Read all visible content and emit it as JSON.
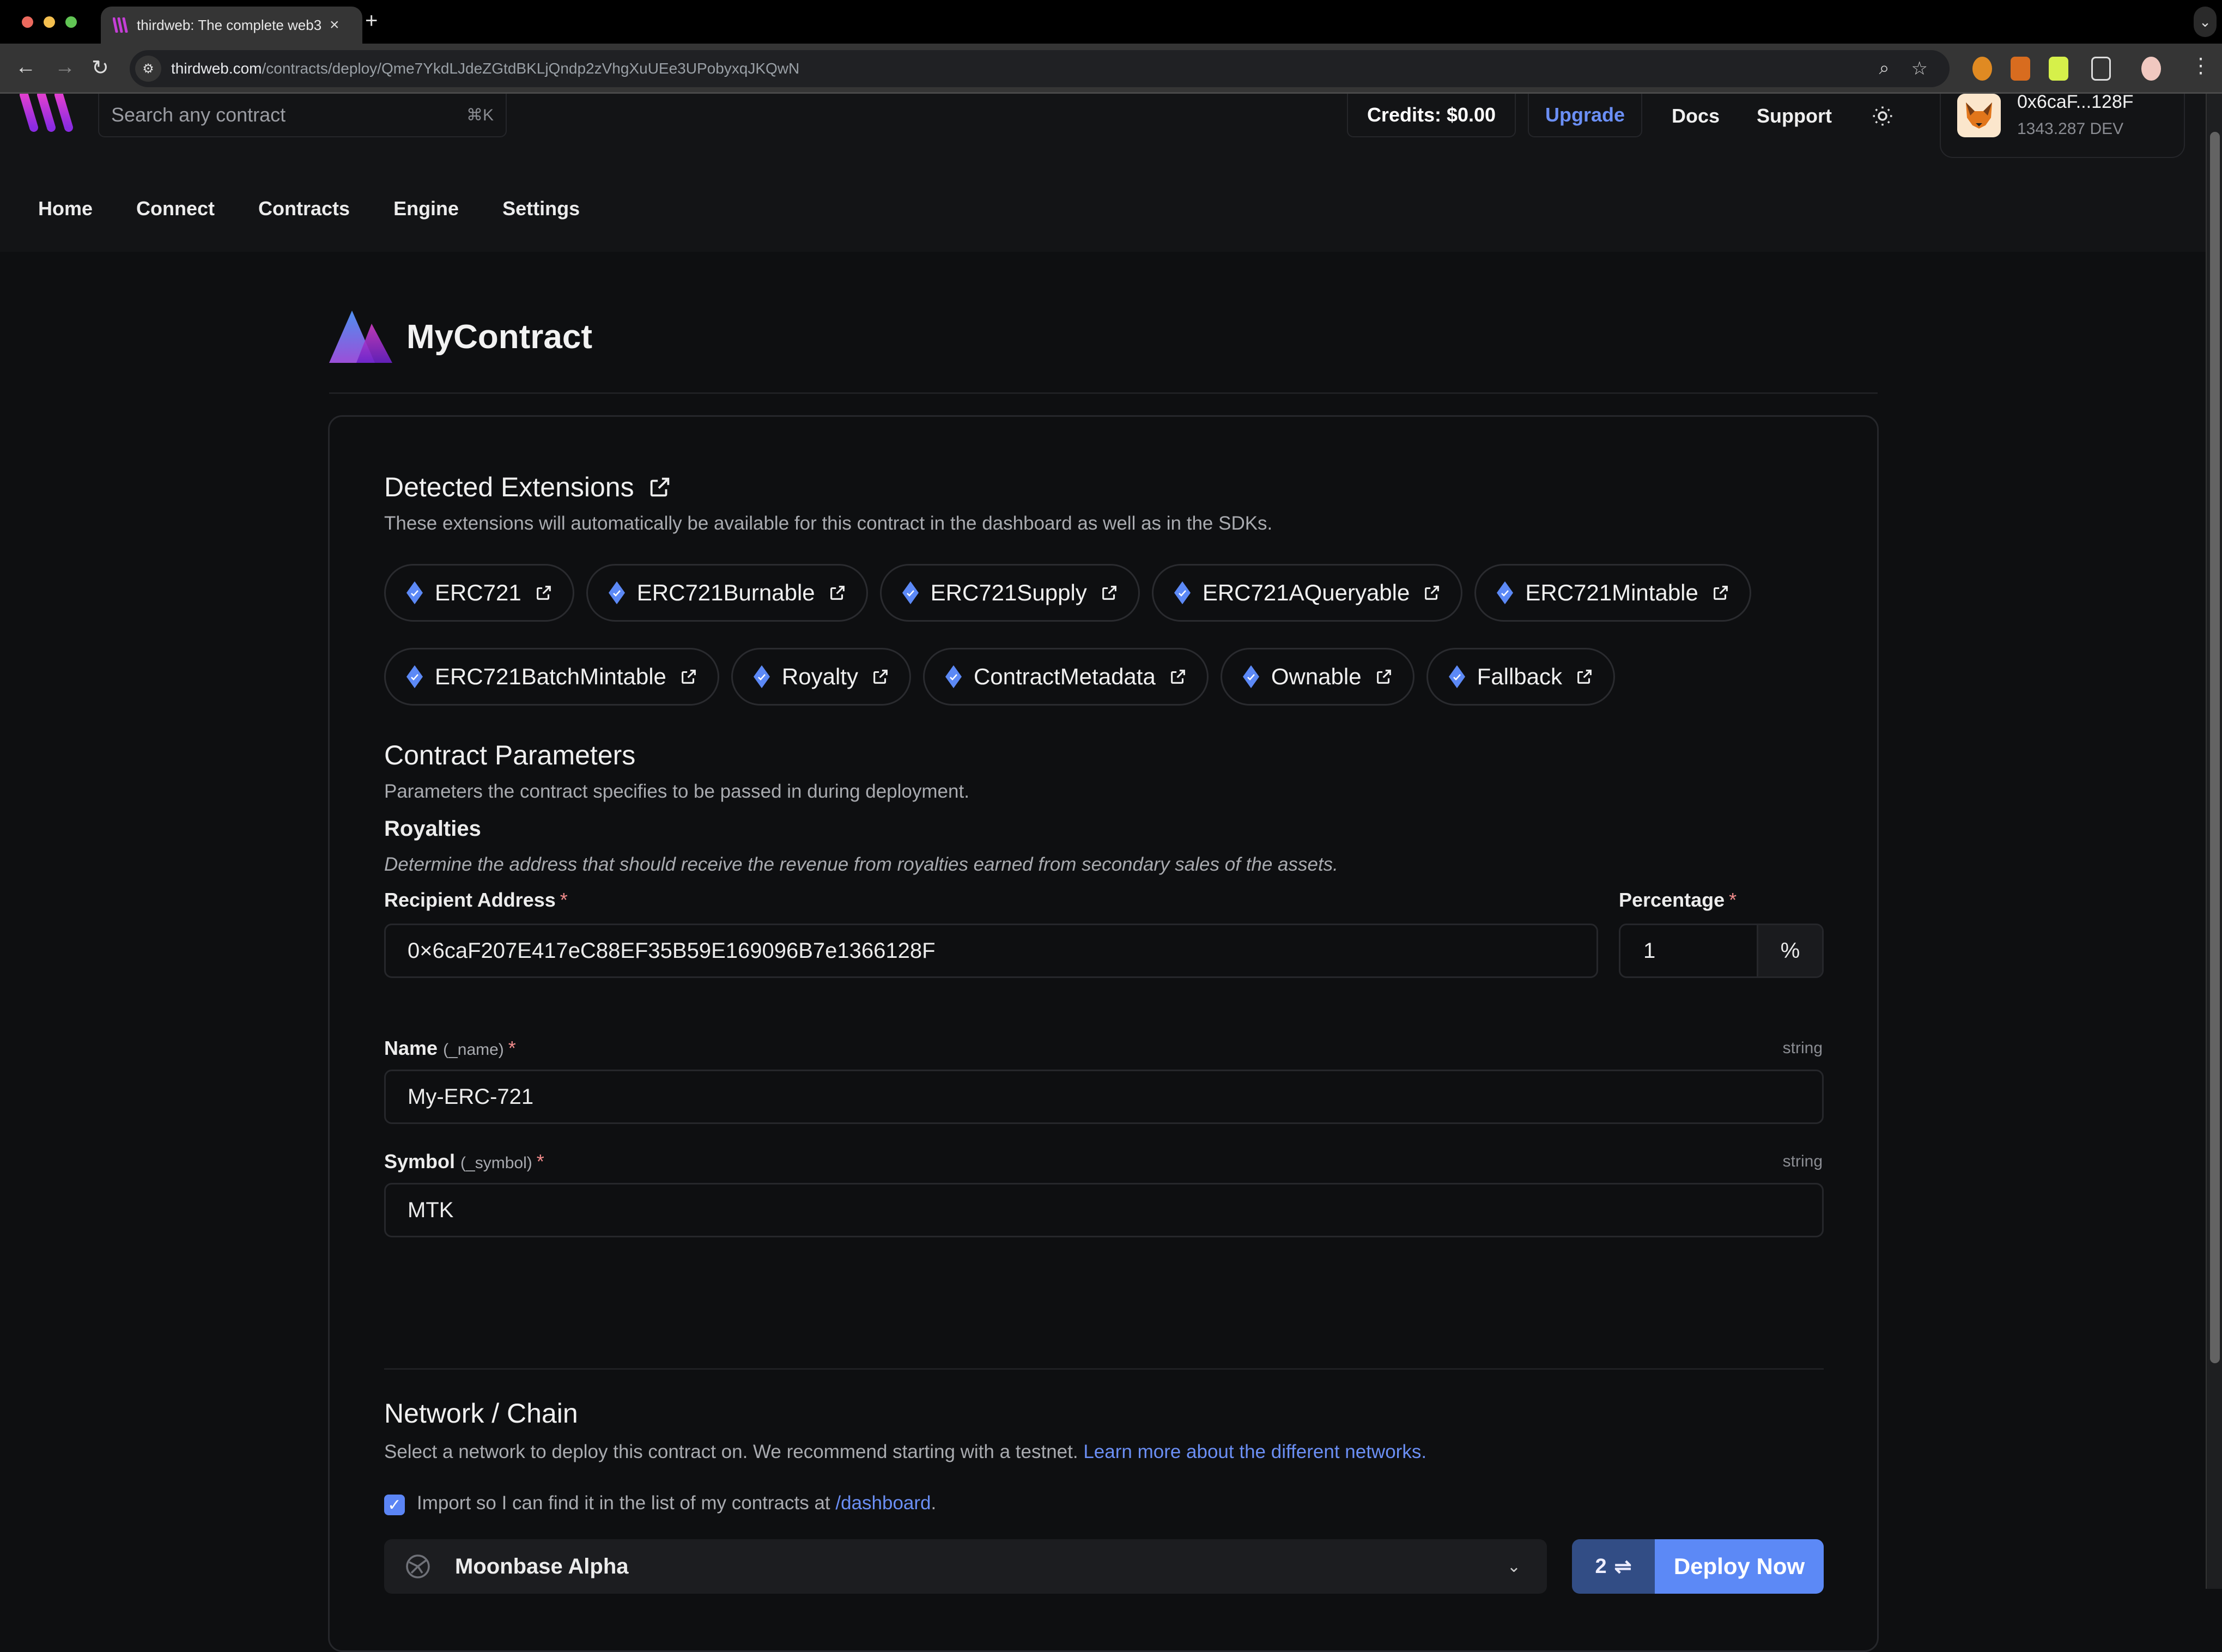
{
  "browser": {
    "tab_title": "thirdweb: The complete web3",
    "url_host": "thirdweb.com",
    "url_path": "/contracts/deploy/Qme7YkdLJdeZGtdBKLjQndp2zVhgXuUEe3UPobyxqJKQwN"
  },
  "header": {
    "search_placeholder": "Search any contract",
    "search_shortcut": "⌘K",
    "credits": "Credits: $0.00",
    "upgrade": "Upgrade",
    "docs": "Docs",
    "support": "Support",
    "wallet_address": "0x6caF...128F",
    "wallet_balance": "1343.287 DEV"
  },
  "nav": [
    "Home",
    "Connect",
    "Contracts",
    "Engine",
    "Settings"
  ],
  "contract": {
    "name": "MyContract"
  },
  "extensions": {
    "title": "Detected Extensions",
    "description": "These extensions will automatically be available for this contract in the dashboard as well as in the SDKs.",
    "items": [
      "ERC721",
      "ERC721Burnable",
      "ERC721Supply",
      "ERC721AQueryable",
      "ERC721Mintable",
      "ERC721BatchMintable",
      "Royalty",
      "ContractMetadata",
      "Ownable",
      "Fallback"
    ]
  },
  "params": {
    "title": "Contract Parameters",
    "description": "Parameters the contract specifies to be passed in during deployment.",
    "royalties_title": "Royalties",
    "royalties_description": "Determine the address that should receive the revenue from royalties earned from secondary sales of the assets.",
    "recipient_label": "Recipient Address",
    "recipient_value": "0×6caF207E417eC88EF35B59E169096B7e1366128F",
    "percentage_label": "Percentage",
    "percentage_value": "1",
    "percentage_suffix": "%",
    "name_label": "Name",
    "name_sub": "(_name)",
    "name_type": "string",
    "name_value": "My-ERC-721",
    "symbol_label": "Symbol",
    "symbol_sub": "(_symbol)",
    "symbol_type": "string",
    "symbol_value": "MTK",
    "required_mark": "*"
  },
  "network": {
    "title": "Network / Chain",
    "description": "Select a network to deploy this contract on. We recommend starting with a testnet.",
    "learn_more": "Learn more about the different networks.",
    "import_text": "Import so I can find it in the list of my contracts at",
    "import_link": "/dashboard",
    "import_checked": true,
    "selected_chain": "Moonbase Alpha",
    "tx_count": "2",
    "deploy_label": "Deploy Now"
  },
  "colors": {
    "accent": "#5c89f6",
    "link": "#6b8ff5",
    "background": "#0e0f11"
  }
}
